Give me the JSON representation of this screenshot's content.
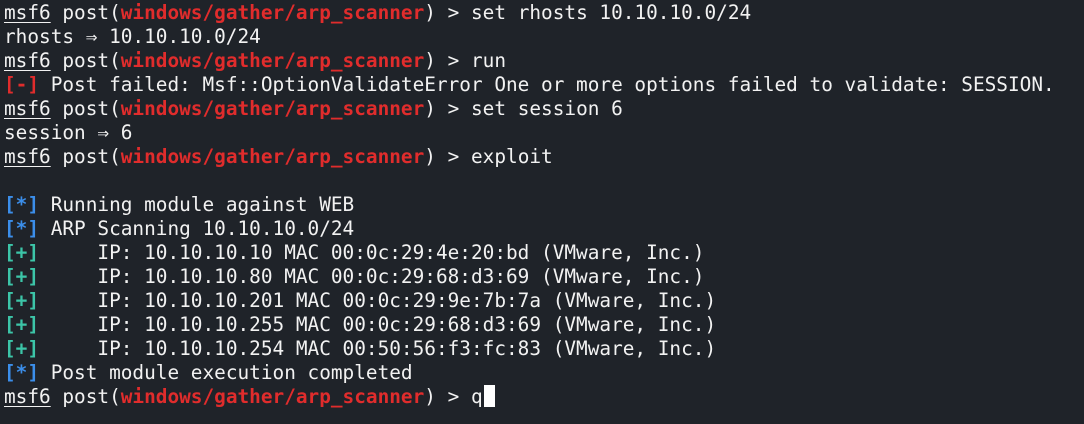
{
  "prompt": {
    "label": "msf6",
    "post_open": " post(",
    "module": "windows/gather/arp_scanner",
    "post_close": ")",
    "arrow": " > "
  },
  "session": [
    {
      "type": "prompt",
      "command": "set rhosts 10.10.10.0/24"
    },
    {
      "type": "output",
      "text": "rhosts ⇒ 10.10.10.0/24"
    },
    {
      "type": "prompt",
      "command": "run"
    },
    {
      "type": "status",
      "marker": "[-]",
      "level": "bad",
      "text": " Post failed: Msf::OptionValidateError One or more options failed to validate: SESSION."
    },
    {
      "type": "prompt",
      "command": "set session 6"
    },
    {
      "type": "output",
      "text": "session ⇒ 6"
    },
    {
      "type": "prompt",
      "command": "exploit"
    },
    {
      "type": "blank"
    },
    {
      "type": "status",
      "marker": "[*]",
      "level": "info",
      "text": " Running module against WEB"
    },
    {
      "type": "status",
      "marker": "[*]",
      "level": "info",
      "text": " ARP Scanning 10.10.10.0/24"
    },
    {
      "type": "status",
      "marker": "[+]",
      "level": "good",
      "text": "     IP: 10.10.10.10 MAC 00:0c:29:4e:20:bd (VMware, Inc.)"
    },
    {
      "type": "status",
      "marker": "[+]",
      "level": "good",
      "text": "     IP: 10.10.10.80 MAC 00:0c:29:68:d3:69 (VMware, Inc.)"
    },
    {
      "type": "status",
      "marker": "[+]",
      "level": "good",
      "text": "     IP: 10.10.10.201 MAC 00:0c:29:9e:7b:7a (VMware, Inc.)"
    },
    {
      "type": "status",
      "marker": "[+]",
      "level": "good",
      "text": "     IP: 10.10.10.255 MAC 00:0c:29:68:d3:69 (VMware, Inc.)"
    },
    {
      "type": "status",
      "marker": "[+]",
      "level": "good",
      "text": "     IP: 10.10.10.254 MAC 00:50:56:f3:fc:83 (VMware, Inc.)"
    },
    {
      "type": "status",
      "marker": "[*]",
      "level": "info",
      "text": " Post module execution completed"
    },
    {
      "type": "prompt",
      "command": "q",
      "cursor": true
    }
  ],
  "colors": {
    "background": "#1f2329",
    "text": "#f2f2f2",
    "module": "#e02c2c",
    "error": "#e02c2c",
    "info": "#3b8eea",
    "success": "#3cc5a8"
  }
}
